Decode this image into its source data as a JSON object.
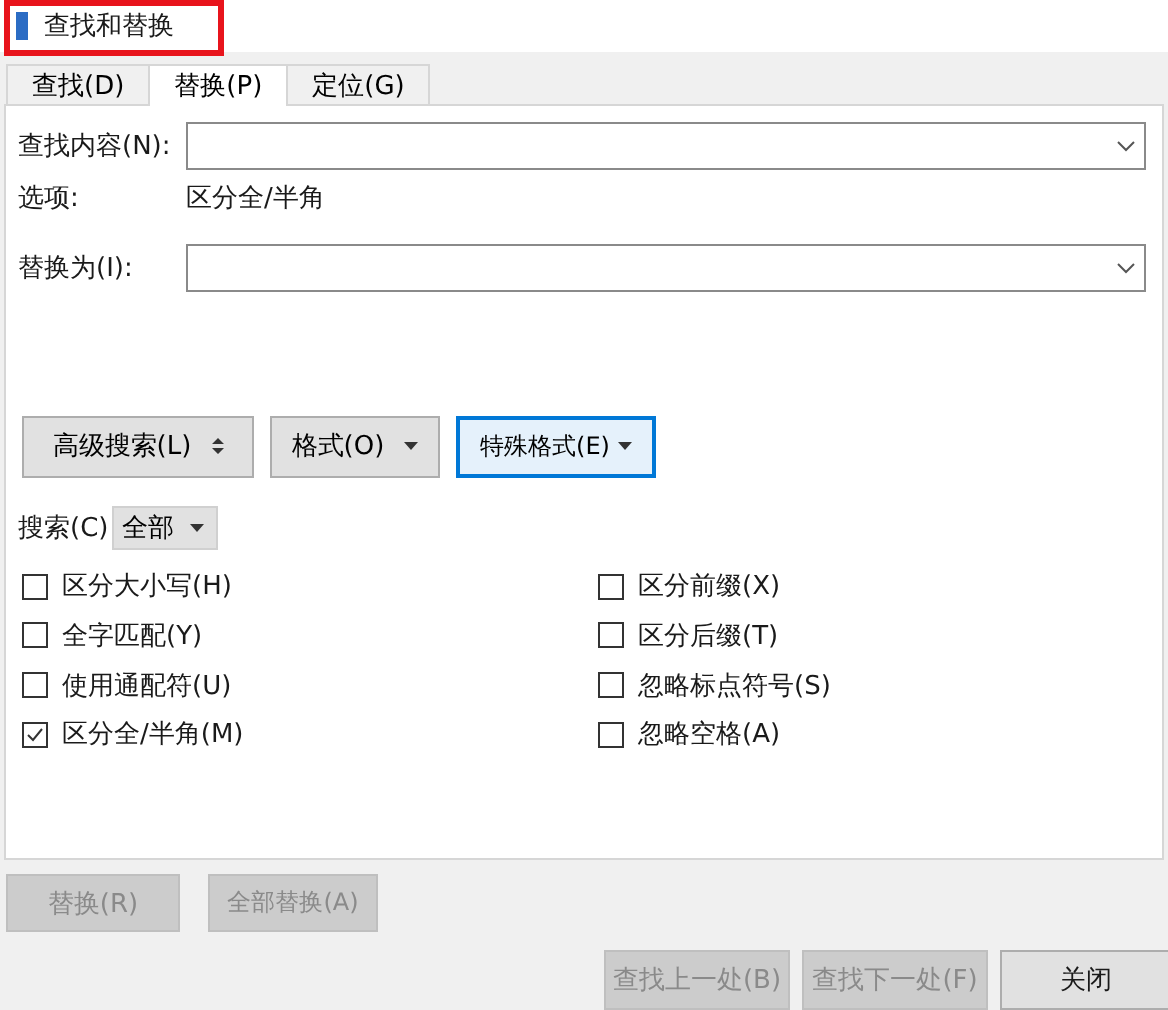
{
  "window": {
    "title": "查找和替换"
  },
  "tabs": [
    {
      "label": "查找(D)",
      "selected": false
    },
    {
      "label": "替换(P)",
      "selected": true
    },
    {
      "label": "定位(G)",
      "selected": false
    }
  ],
  "find": {
    "label": "查找内容(N):"
  },
  "options": {
    "label": "选项:",
    "value": "区分全/半角"
  },
  "replace": {
    "label": "替换为(I):"
  },
  "tool_buttons": [
    {
      "label": "高级搜索(L)",
      "kind": "updown",
      "focused": false
    },
    {
      "label": "格式(O)",
      "kind": "dropdown",
      "focused": false
    },
    {
      "label": "特殊格式(E)",
      "kind": "dropdown",
      "focused": true
    }
  ],
  "search": {
    "label": "搜索(C)",
    "value": "全部"
  },
  "checkboxes_left": [
    {
      "label": "区分大小写(H)",
      "checked": false
    },
    {
      "label": "全字匹配(Y)",
      "checked": false
    },
    {
      "label": "使用通配符(U)",
      "checked": false
    },
    {
      "label": "区分全/半角(M)",
      "checked": true
    }
  ],
  "checkboxes_right": [
    {
      "label": "区分前缀(X)",
      "checked": false
    },
    {
      "label": "区分后缀(T)",
      "checked": false
    },
    {
      "label": "忽略标点符号(S)",
      "checked": false
    },
    {
      "label": "忽略空格(A)",
      "checked": false
    }
  ],
  "replace_buttons": [
    {
      "label": "替换(R)",
      "disabled": true
    },
    {
      "label": "全部替换(A)",
      "disabled": true
    }
  ],
  "nav_buttons": [
    {
      "label": "查找上一处(B)",
      "disabled": true
    },
    {
      "label": "查找下一处(F)",
      "disabled": true
    },
    {
      "label": "关闭",
      "disabled": false
    }
  ]
}
